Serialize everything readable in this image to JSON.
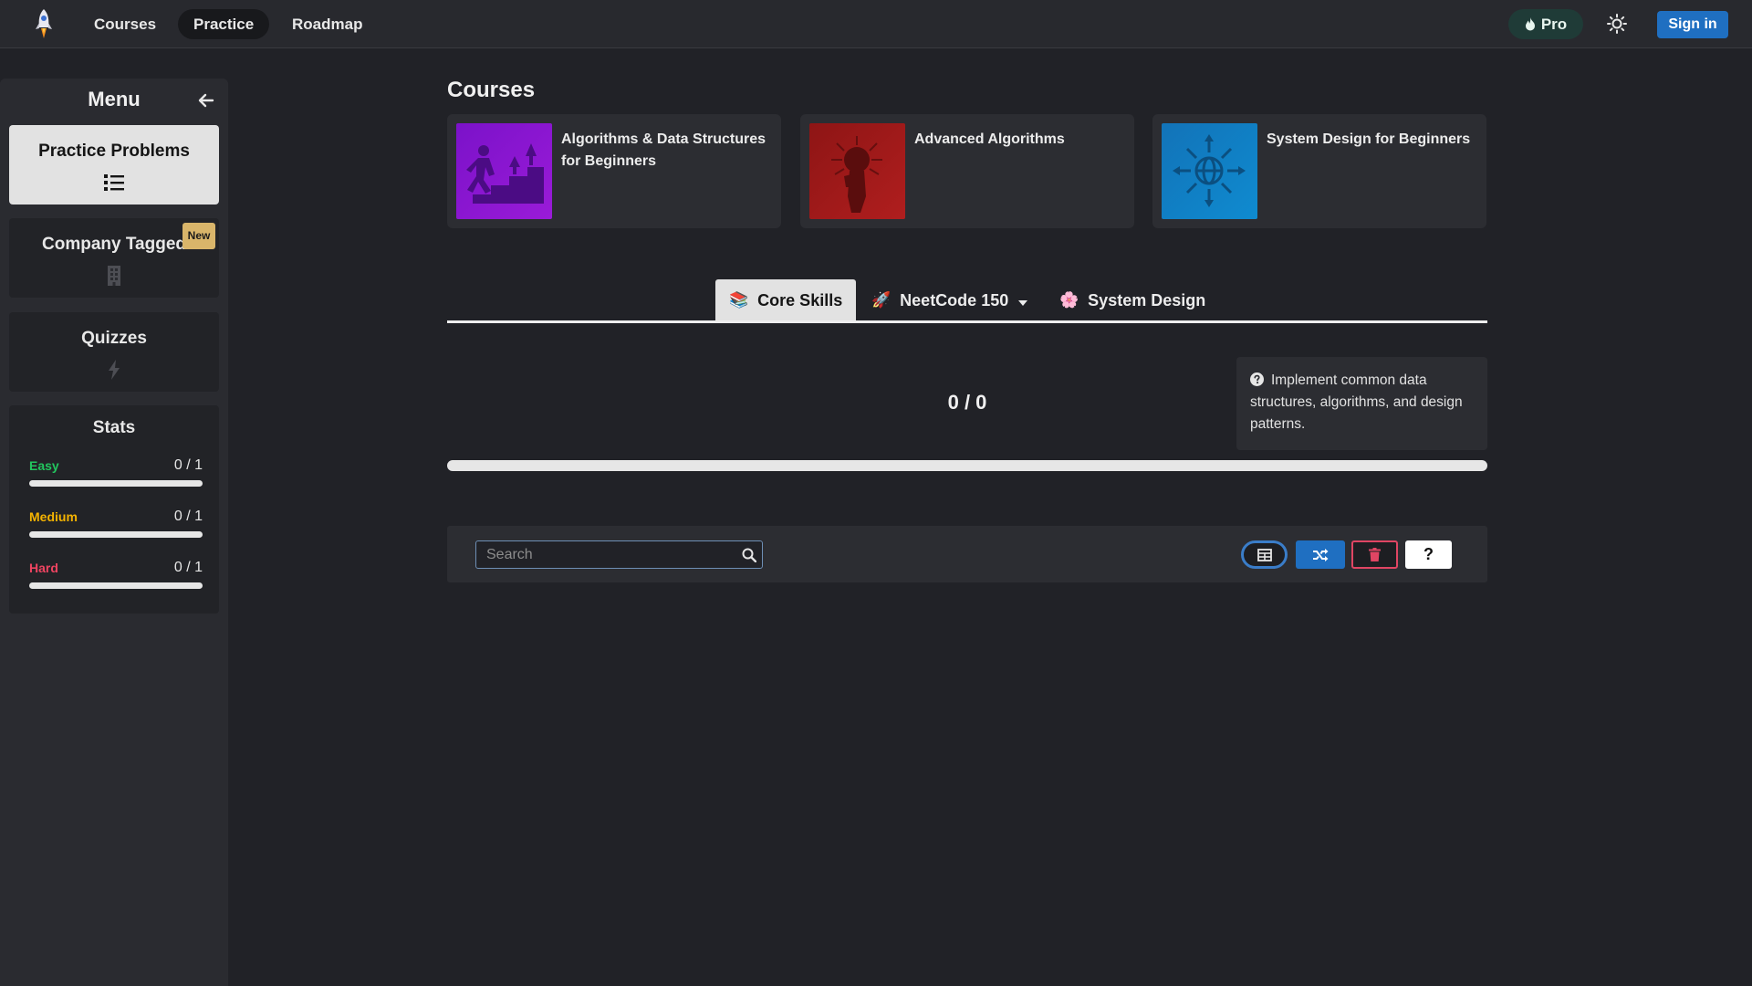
{
  "nav": {
    "links": [
      "Courses",
      "Practice",
      "Roadmap"
    ],
    "active": "Practice",
    "pro_label": "Pro",
    "signin_label": "Sign in"
  },
  "sidebar": {
    "title": "Menu",
    "items": [
      {
        "label": "Practice Problems",
        "icon": "list-icon",
        "active": true
      },
      {
        "label": "Company Tagged",
        "icon": "building-icon",
        "badge": "New"
      },
      {
        "label": "Quizzes",
        "icon": "lightning-icon"
      }
    ],
    "stats": {
      "title": "Stats",
      "rows": [
        {
          "name": "Easy",
          "count": "0 / 1",
          "color": "#22c55e",
          "fraction": 0
        },
        {
          "name": "Medium",
          "count": "0 / 1",
          "color": "#f5b301",
          "fraction": 0
        },
        {
          "name": "Hard",
          "count": "0 / 1",
          "color": "#ef4461",
          "fraction": 0
        }
      ]
    }
  },
  "main": {
    "courses_title": "Courses",
    "courses": [
      {
        "name": "Algorithms & Data Structures for Beginners",
        "icon": "stairs-climb-icon"
      },
      {
        "name": "Advanced Algorithms",
        "icon": "brain-hand-icon"
      },
      {
        "name": "System Design for Beginners",
        "icon": "globe-network-icon"
      }
    ],
    "tabs": [
      {
        "label": "Core Skills",
        "emoji": "📚",
        "active": true
      },
      {
        "label": "NeetCode 150",
        "emoji": "🚀",
        "dropdown": true
      },
      {
        "label": "System Design",
        "emoji": "🌸"
      }
    ],
    "progress": "0 / 0",
    "progress_fraction": 0,
    "info_text": "Implement common data structures, algorithms, and design patterns.",
    "search_placeholder": "Search"
  },
  "colors": {
    "accent_blue": "#1f6fc1",
    "pro_green": "#1f3b37",
    "danger": "#e04563"
  }
}
